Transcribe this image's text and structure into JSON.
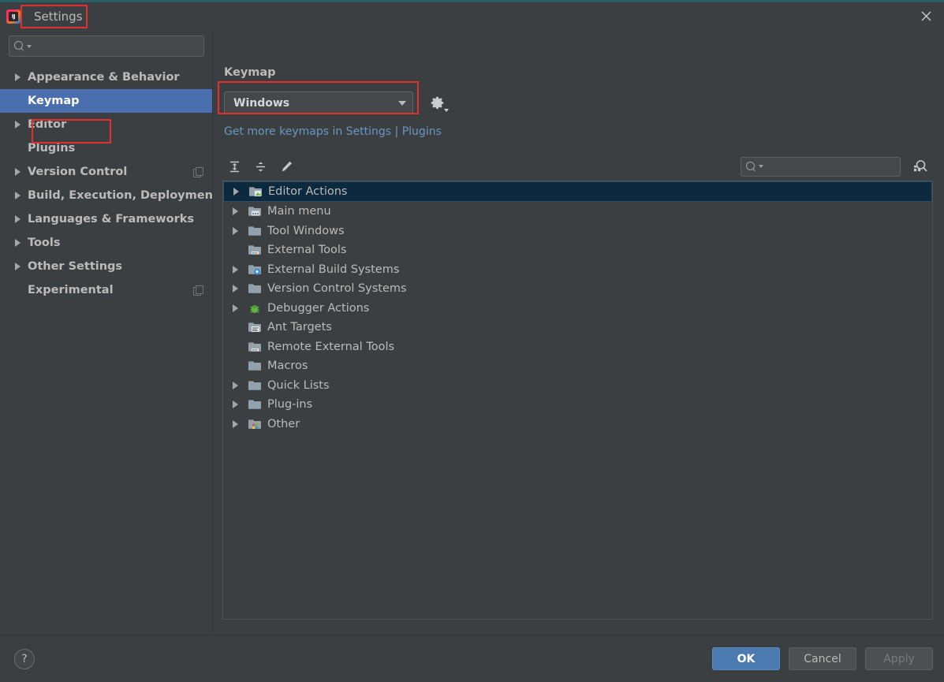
{
  "window": {
    "title": "Settings",
    "app_icon": "intellij-idea-icon",
    "close_icon": "close-icon",
    "accent_color": "#2b5f63"
  },
  "sidebar": {
    "search": {
      "value": "",
      "placeholder": "",
      "icon": "search-icon"
    },
    "items": [
      {
        "label": "Appearance & Behavior",
        "expandable": true,
        "selected": false,
        "badge": false
      },
      {
        "label": "Keymap",
        "expandable": false,
        "selected": true,
        "badge": false
      },
      {
        "label": "Editor",
        "expandable": true,
        "selected": false,
        "badge": false
      },
      {
        "label": "Plugins",
        "expandable": false,
        "selected": false,
        "badge": false
      },
      {
        "label": "Version Control",
        "expandable": true,
        "selected": false,
        "badge": true
      },
      {
        "label": "Build, Execution, Deployment",
        "expandable": true,
        "selected": false,
        "badge": false
      },
      {
        "label": "Languages & Frameworks",
        "expandable": true,
        "selected": false,
        "badge": false
      },
      {
        "label": "Tools",
        "expandable": true,
        "selected": false,
        "badge": false
      },
      {
        "label": "Other Settings",
        "expandable": true,
        "selected": false,
        "badge": false
      },
      {
        "label": "Experimental",
        "expandable": false,
        "selected": false,
        "badge": true
      }
    ]
  },
  "main": {
    "title": "Keymap",
    "keymap_select": {
      "value": "Windows",
      "caret_icon": "chevron-down-icon"
    },
    "gear_icon": "gear-icon",
    "link": "Get more keymaps in Settings | Plugins",
    "toolbar": {
      "expand_all": "expand-all-icon",
      "collapse_all": "collapse-all-icon",
      "edit": "edit-pencil-icon",
      "search": {
        "value": "",
        "placeholder": "",
        "icon": "search-icon"
      },
      "find_by_shortcut": "find-by-shortcut-icon"
    },
    "tree": [
      {
        "label": "Editor Actions",
        "expandable": true,
        "selected": true,
        "icon": "folder-editor-icon"
      },
      {
        "label": "Main menu",
        "expandable": true,
        "selected": false,
        "icon": "folder-menu-icon"
      },
      {
        "label": "Tool Windows",
        "expandable": true,
        "selected": false,
        "icon": "folder-icon"
      },
      {
        "label": "External Tools",
        "expandable": false,
        "selected": false,
        "icon": "folder-tools-icon"
      },
      {
        "label": "External Build Systems",
        "expandable": true,
        "selected": false,
        "icon": "folder-build-icon"
      },
      {
        "label": "Version Control Systems",
        "expandable": true,
        "selected": false,
        "icon": "folder-icon"
      },
      {
        "label": "Debugger Actions",
        "expandable": true,
        "selected": false,
        "icon": "debugger-bug-icon"
      },
      {
        "label": "Ant Targets",
        "expandable": false,
        "selected": false,
        "icon": "folder-ant-icon"
      },
      {
        "label": "Remote External Tools",
        "expandable": false,
        "selected": false,
        "icon": "folder-tools-icon"
      },
      {
        "label": "Macros",
        "expandable": false,
        "selected": false,
        "icon": "folder-icon"
      },
      {
        "label": "Quick Lists",
        "expandable": true,
        "selected": false,
        "icon": "folder-icon"
      },
      {
        "label": "Plug-ins",
        "expandable": true,
        "selected": false,
        "icon": "folder-icon"
      },
      {
        "label": "Other",
        "expandable": true,
        "selected": false,
        "icon": "folder-other-icon"
      }
    ]
  },
  "footer": {
    "help_label": "?",
    "ok_label": "OK",
    "cancel_label": "Cancel",
    "apply_label": "Apply",
    "apply_disabled": true
  },
  "highlights": [
    {
      "name": "settings-title-highlight"
    },
    {
      "name": "keymap-sidebar-highlight"
    },
    {
      "name": "keymap-select-highlight"
    }
  ]
}
